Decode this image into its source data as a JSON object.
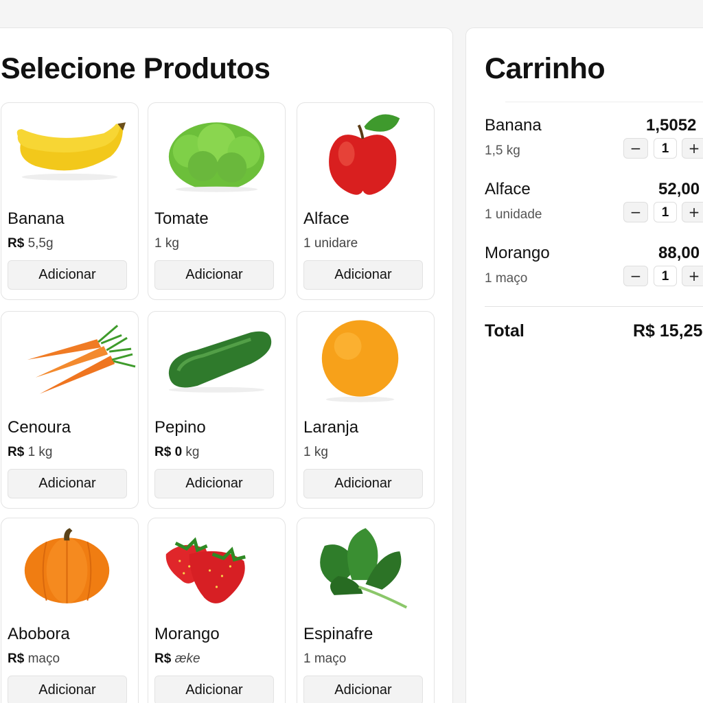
{
  "products": {
    "title": "Selecione Produtos",
    "add_label": "Adicionar",
    "items": [
      {
        "name": "Banana",
        "price_prefix": "R$",
        "price_text": "5,5g",
        "icon": "banana-icon"
      },
      {
        "name": "Tomate",
        "price_prefix": "",
        "price_text": "1 kg",
        "icon": "lettuce-icon"
      },
      {
        "name": "Alface",
        "price_prefix": "",
        "price_text": "1 unidare",
        "icon": "apple-icon"
      },
      {
        "name": "Cenoura",
        "price_prefix": "R$",
        "price_text": "1 kg",
        "icon": "carrot-icon"
      },
      {
        "name": "Pepino",
        "price_prefix": "R$ 0",
        "price_text": "kg",
        "icon": "cucumber-icon"
      },
      {
        "name": "Laranja",
        "price_prefix": "",
        "price_text": "1 kg",
        "icon": "orange-icon"
      },
      {
        "name": "Abobora",
        "price_prefix": "R$",
        "price_text": "maço",
        "icon": "pumpkin-icon"
      },
      {
        "name": "Morango",
        "price_prefix": "R$",
        "price_text": "ӕke",
        "icon": "strawberry-icon"
      },
      {
        "name": "Espinafre",
        "price_prefix": "",
        "price_text": "1 maço",
        "icon": "spinach-icon"
      }
    ]
  },
  "cart": {
    "title": "Carrinho",
    "minus_symbol": "−",
    "plus_symbol": "+",
    "items": [
      {
        "name": "Banana",
        "price": "1,5052",
        "qty_label": "1,5 kg",
        "qty": "1"
      },
      {
        "name": "Alface",
        "price": "52,00",
        "qty_label": "1 unidade",
        "qty": "1"
      },
      {
        "name": "Morango",
        "price": "88,00",
        "qty_label": "1 maço",
        "qty": "1"
      }
    ],
    "total_label": "Total",
    "total_value": "R$ 15,25"
  }
}
